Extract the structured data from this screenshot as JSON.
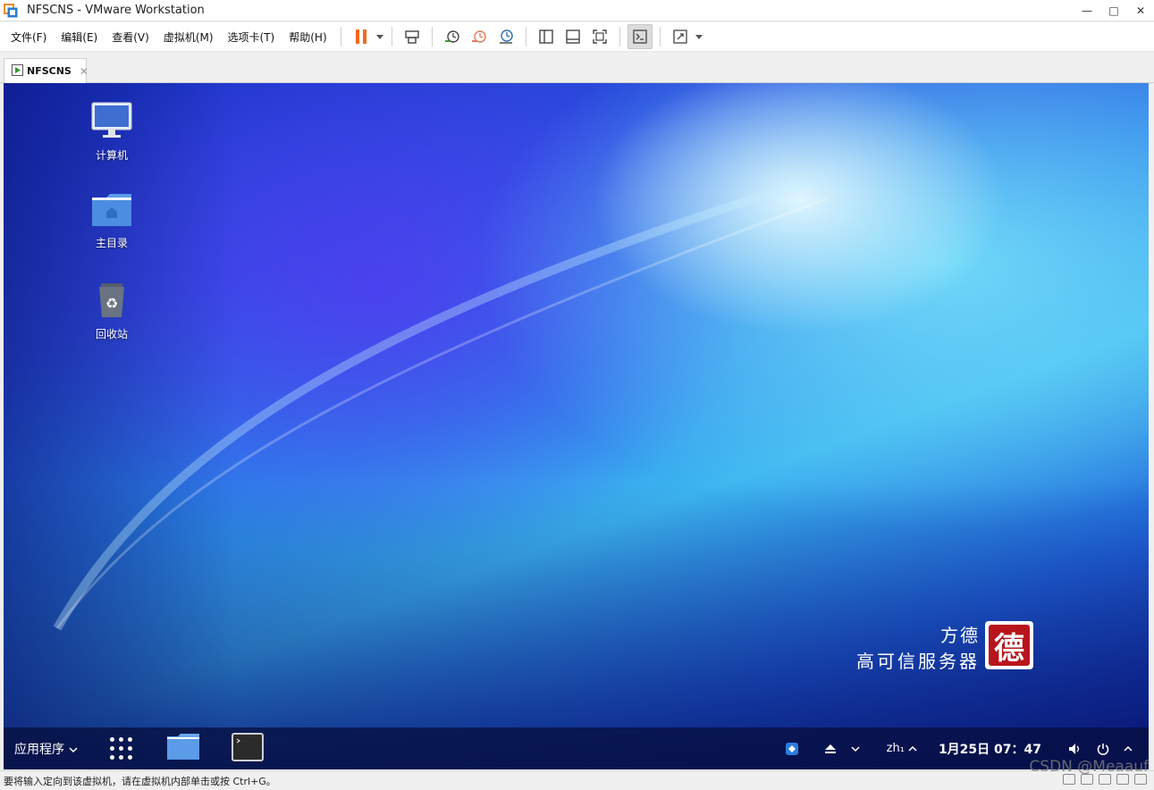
{
  "window": {
    "title": "NFSCNS - VMware Workstation",
    "minimize_glyph": "—",
    "maximize_glyph": "□",
    "close_glyph": "✕"
  },
  "menubar": {
    "items": [
      "文件(F)",
      "编辑(E)",
      "查看(V)",
      "虚拟机(M)",
      "选项卡(T)",
      "帮助(H)"
    ]
  },
  "toolbar": {
    "icons": [
      "pause-icon",
      "send-ctrl-alt-del-icon",
      "snapshot-icon",
      "revert-snapshot-icon",
      "snapshot-manager-icon",
      "show-library-icon",
      "show-thumbnails-icon",
      "fullscreen-icon",
      "console-view-icon",
      "stretch-icon"
    ],
    "accent": "#f26a1b"
  },
  "tab": {
    "label": "NFSCNS",
    "close_glyph": "✕"
  },
  "desktop": {
    "icons": [
      {
        "label": "计算机",
        "icon": "computer-icon"
      },
      {
        "label": "主目录",
        "icon": "home-folder-icon"
      },
      {
        "label": "回收站",
        "icon": "trash-icon"
      }
    ],
    "brand_line1": "方德",
    "brand_line2": "高可信服务器",
    "brand_seal": "德"
  },
  "taskbar": {
    "apps_label": "应用程序",
    "lang": "zh₁",
    "datetime": "1月25日  07：47"
  },
  "statusbar": {
    "text": "要将输入定向到该虚拟机，请在虚拟机内部单击或按 Ctrl+G。",
    "watermark": "CSDN @Meaauf"
  }
}
